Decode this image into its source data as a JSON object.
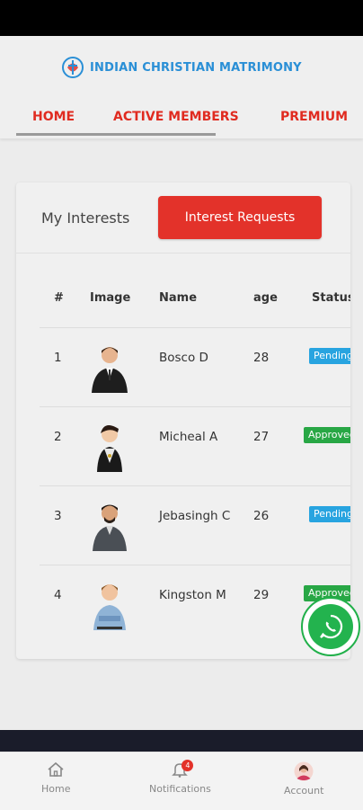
{
  "brand": {
    "title": "INDIAN CHRISTIAN MATRIMONY"
  },
  "nav": {
    "items": [
      {
        "label": "HOME"
      },
      {
        "label": "ACTIVE MEMBERS"
      },
      {
        "label": "PREMIUM"
      }
    ]
  },
  "tabs": {
    "my_interests": "My Interests",
    "interest_requests": "Interest Requests"
  },
  "table": {
    "headers": {
      "num": "#",
      "image": "Image",
      "name": "Name",
      "age": "age",
      "status": "Status"
    },
    "rows": [
      {
        "num": "1",
        "name": "Bosco D",
        "age": "28",
        "status": "Pending"
      },
      {
        "num": "2",
        "name": "Micheal A",
        "age": "27",
        "status": "Approved"
      },
      {
        "num": "3",
        "name": "Jebasingh C",
        "age": "26",
        "status": "Pending"
      },
      {
        "num": "4",
        "name": "Kingston M",
        "age": "29",
        "status": "Approved"
      }
    ]
  },
  "bottom_nav": {
    "home": "Home",
    "notifications": "Notifications",
    "notification_count": "4",
    "account": "Account"
  },
  "colors": {
    "accent": "#e3322a",
    "brand": "#2a8fd6",
    "pending": "#28a4e0",
    "approved": "#28a745",
    "whatsapp": "#23b34e"
  }
}
